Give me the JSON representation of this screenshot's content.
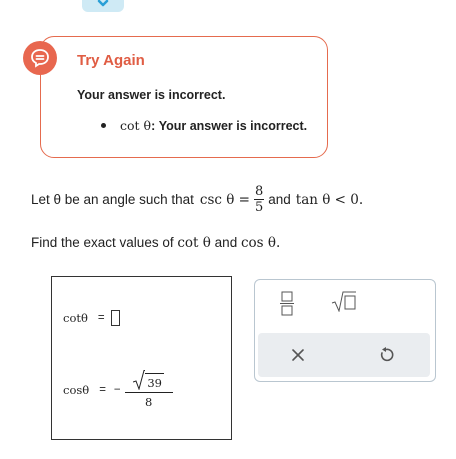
{
  "feedback": {
    "title": "Try Again",
    "message": "Your answer is incorrect.",
    "bullet_func": "cot θ",
    "bullet_text": ": Your answer is incorrect."
  },
  "problem": {
    "let_text": "Let θ be an angle such that",
    "csc_label": "csc θ =",
    "csc_num": "8",
    "csc_den": "5",
    "and_text": "and",
    "tan_condition": "tan θ < 0.",
    "find_text_1": "Find the exact values of",
    "find_cot": "cot θ",
    "find_and": "and",
    "find_cos": "cos θ."
  },
  "answer": {
    "cot_label": "cotθ",
    "cot_eq": "=",
    "cos_label": "cosθ",
    "cos_eq": "=",
    "cos_sign": "−",
    "cos_radicand": "39",
    "cos_den": "8"
  },
  "toolbox": {
    "clear_symbol": "×",
    "undo_symbol": "↺"
  }
}
